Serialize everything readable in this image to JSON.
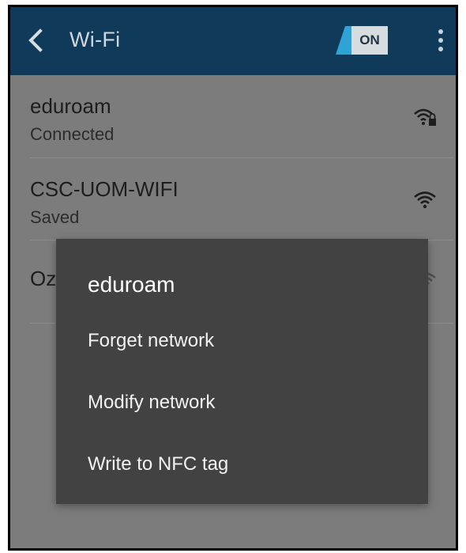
{
  "app_bar": {
    "title": "Wi-Fi",
    "toggle_label": "ON",
    "back_icon": "chevron-left-icon",
    "overflow_icon": "more-vert-icon"
  },
  "networks": [
    {
      "ssid": "eduroam",
      "status": "Connected",
      "icon": "wifi-lock-icon"
    },
    {
      "ssid": "CSC-UOM-WIFI",
      "status": "Saved",
      "icon": "wifi-icon"
    },
    {
      "ssid": "Oz",
      "status": "",
      "icon": "wifi-icon"
    }
  ],
  "dialog": {
    "title": "eduroam",
    "items": [
      {
        "label": "Forget network"
      },
      {
        "label": "Modify network"
      },
      {
        "label": "Write to NFC tag"
      }
    ]
  },
  "colors": {
    "app_bar": "#0f3a59",
    "toggle_accent": "#2fa3d6",
    "dialog_bg": "#424242",
    "scrim": "#7c7c7c"
  }
}
